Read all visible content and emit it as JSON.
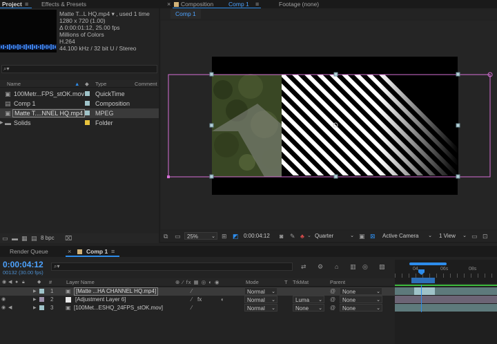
{
  "top_tabs": {
    "project": "Project",
    "effects": "Effects & Presets",
    "composition": "Composition",
    "composition_name": "Comp 1",
    "footage": "Footage (none)",
    "comp_sub_tab": "Comp 1"
  },
  "project_info": {
    "name_line": "Matte T...L HQ.mp4 ▾ , used 1 time",
    "line2": "1280 x 720 (1.00)",
    "line3": "Δ 0:00:01:12, 25.00 fps",
    "line4": "Millions of Colors",
    "line5": "H.264",
    "line6": "44.100 kHz / 32 bit U / Stereo"
  },
  "project_columns": {
    "name": "Name",
    "type": "Type",
    "comment": "Comment"
  },
  "project_items": [
    {
      "name": "100Metr...FPS_stOK.mov",
      "type": "QuickTime",
      "swatch": "#9fc3c9",
      "icon": "film-icon"
    },
    {
      "name": "Comp 1",
      "type": "Composition",
      "swatch": "#9fc3c9",
      "icon": "composition-icon"
    },
    {
      "name": "Matte T....NNEL HQ.mp4",
      "type": "MPEG",
      "swatch": "#9fc3c9",
      "icon": "film-icon"
    },
    {
      "name": "Solids",
      "type": "Folder",
      "swatch": "#e8c33d",
      "icon": "folder-icon"
    }
  ],
  "project_footer": {
    "bpc": "8 bpc"
  },
  "viewer_toolbar": {
    "zoom": "25%",
    "timecode": "0:00:04:12",
    "resolution": "Quarter",
    "camera": "Active Camera",
    "views": "1 View"
  },
  "timeline_tabs": {
    "render_queue": "Render Queue",
    "comp": "Comp 1"
  },
  "timeline": {
    "current_time": "0:00:04:12",
    "frame_info": "00132 (30.00 fps)",
    "ruler_labels": [
      "04",
      "06s",
      "08s"
    ]
  },
  "timeline_columns": {
    "number": "#",
    "layer_name": "Layer Name",
    "mode": "Mode",
    "t": "T",
    "trkmat": "TrkMat",
    "parent": "Parent"
  },
  "layers": [
    {
      "num": "1",
      "name": "[Matte ...HA CHANNEL HQ.mp4]",
      "mode": "Normal",
      "trkmat": "",
      "parent": "None",
      "swatch": "#9fc3c9"
    },
    {
      "num": "2",
      "name": "[Adjustment Layer 6]",
      "mode": "Normal",
      "trkmat": "Luma",
      "parent": "None",
      "swatch": "#9a8ea8"
    },
    {
      "num": "3",
      "name": "[100Met...ESHQ_24FPS_stOK.mov]",
      "mode": "Normal",
      "trkmat": "None",
      "parent": "None",
      "swatch": "#9fc3c9"
    }
  ],
  "colors": {
    "accent": "#2d8ceb",
    "layer_bounds": "#d66fd6",
    "work_area": "#2d8ceb",
    "layer_bar": "#6f7f82"
  }
}
